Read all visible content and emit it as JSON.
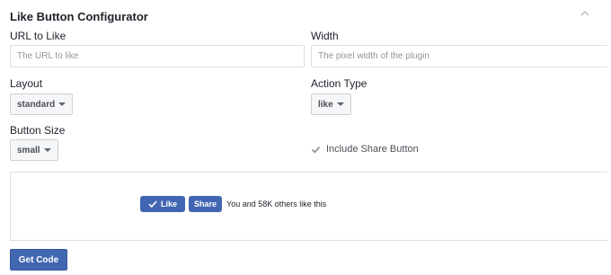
{
  "header": {
    "title": "Like Button Configurator",
    "collapse_icon": "chevron-up-icon"
  },
  "fields": {
    "url": {
      "label": "URL to Like",
      "placeholder": "The URL to like",
      "value": ""
    },
    "width": {
      "label": "Width",
      "placeholder": "The pixel width of the plugin",
      "value": ""
    },
    "layout": {
      "label": "Layout",
      "selected": "standard",
      "icon": "caret-down-icon"
    },
    "action_type": {
      "label": "Action Type",
      "selected": "like",
      "icon": "caret-down-icon"
    },
    "button_size": {
      "label": "Button Size",
      "selected": "small",
      "icon": "caret-down-icon"
    },
    "share": {
      "label": "Include Share Button",
      "checked": true,
      "icon": "checkmark-icon"
    }
  },
  "preview": {
    "like_label": "Like",
    "like_icon": "thumbs-check-icon",
    "share_label": "Share",
    "social_text": "You and 58K others like this"
  },
  "actions": {
    "get_code_label": "Get Code"
  },
  "colors": {
    "brand_blue": "#4267b2",
    "text": "#1d2129",
    "border": "#dddfe2"
  }
}
